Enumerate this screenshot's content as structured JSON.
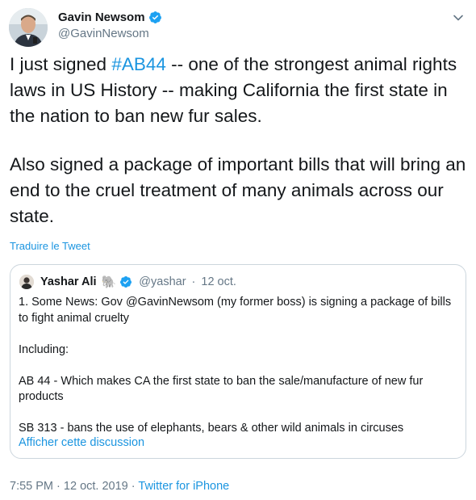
{
  "tweet": {
    "author": {
      "name": "Gavin Newsom",
      "handle": "@GavinNewsom",
      "verified": true
    },
    "text_parts": {
      "pre": "I just signed ",
      "hashtag": "#AB44",
      "post": " -- one of the strongest animal rights laws in US History -- making California the first state in the nation to ban new fur sales."
    },
    "paragraph2": "Also signed a package of important bills that will bring an end to the cruel treatment of many animals across our state.",
    "translate_label": "Traduire le Tweet",
    "quoted": {
      "name": "Yashar Ali",
      "emoji": "🐘",
      "handle": "@yashar",
      "separator": "·",
      "date": "12 oct.",
      "paragraphs": [
        "1. Some News: Gov @GavinNewsom (my former boss) is signing a package of bills to fight animal cruelty",
        "Including:",
        "AB 44 - Which makes CA the first state to ban the sale/manufacture of new fur products",
        "SB 313 -  bans the use of elephants, bears & other wild animals in circuses"
      ],
      "thread_link": "Afficher cette discussion"
    },
    "meta": {
      "time": "7:55 PM",
      "dot1": "·",
      "date": "12 oct. 2019",
      "dot2": "·",
      "source": "Twitter for iPhone"
    }
  },
  "colors": {
    "link": "#1b95e0",
    "text": "#14171a",
    "muted": "#657786",
    "border": "#ccd6dd"
  },
  "icons": {
    "verified": "verified-badge-icon",
    "caret": "chevron-down-icon"
  }
}
